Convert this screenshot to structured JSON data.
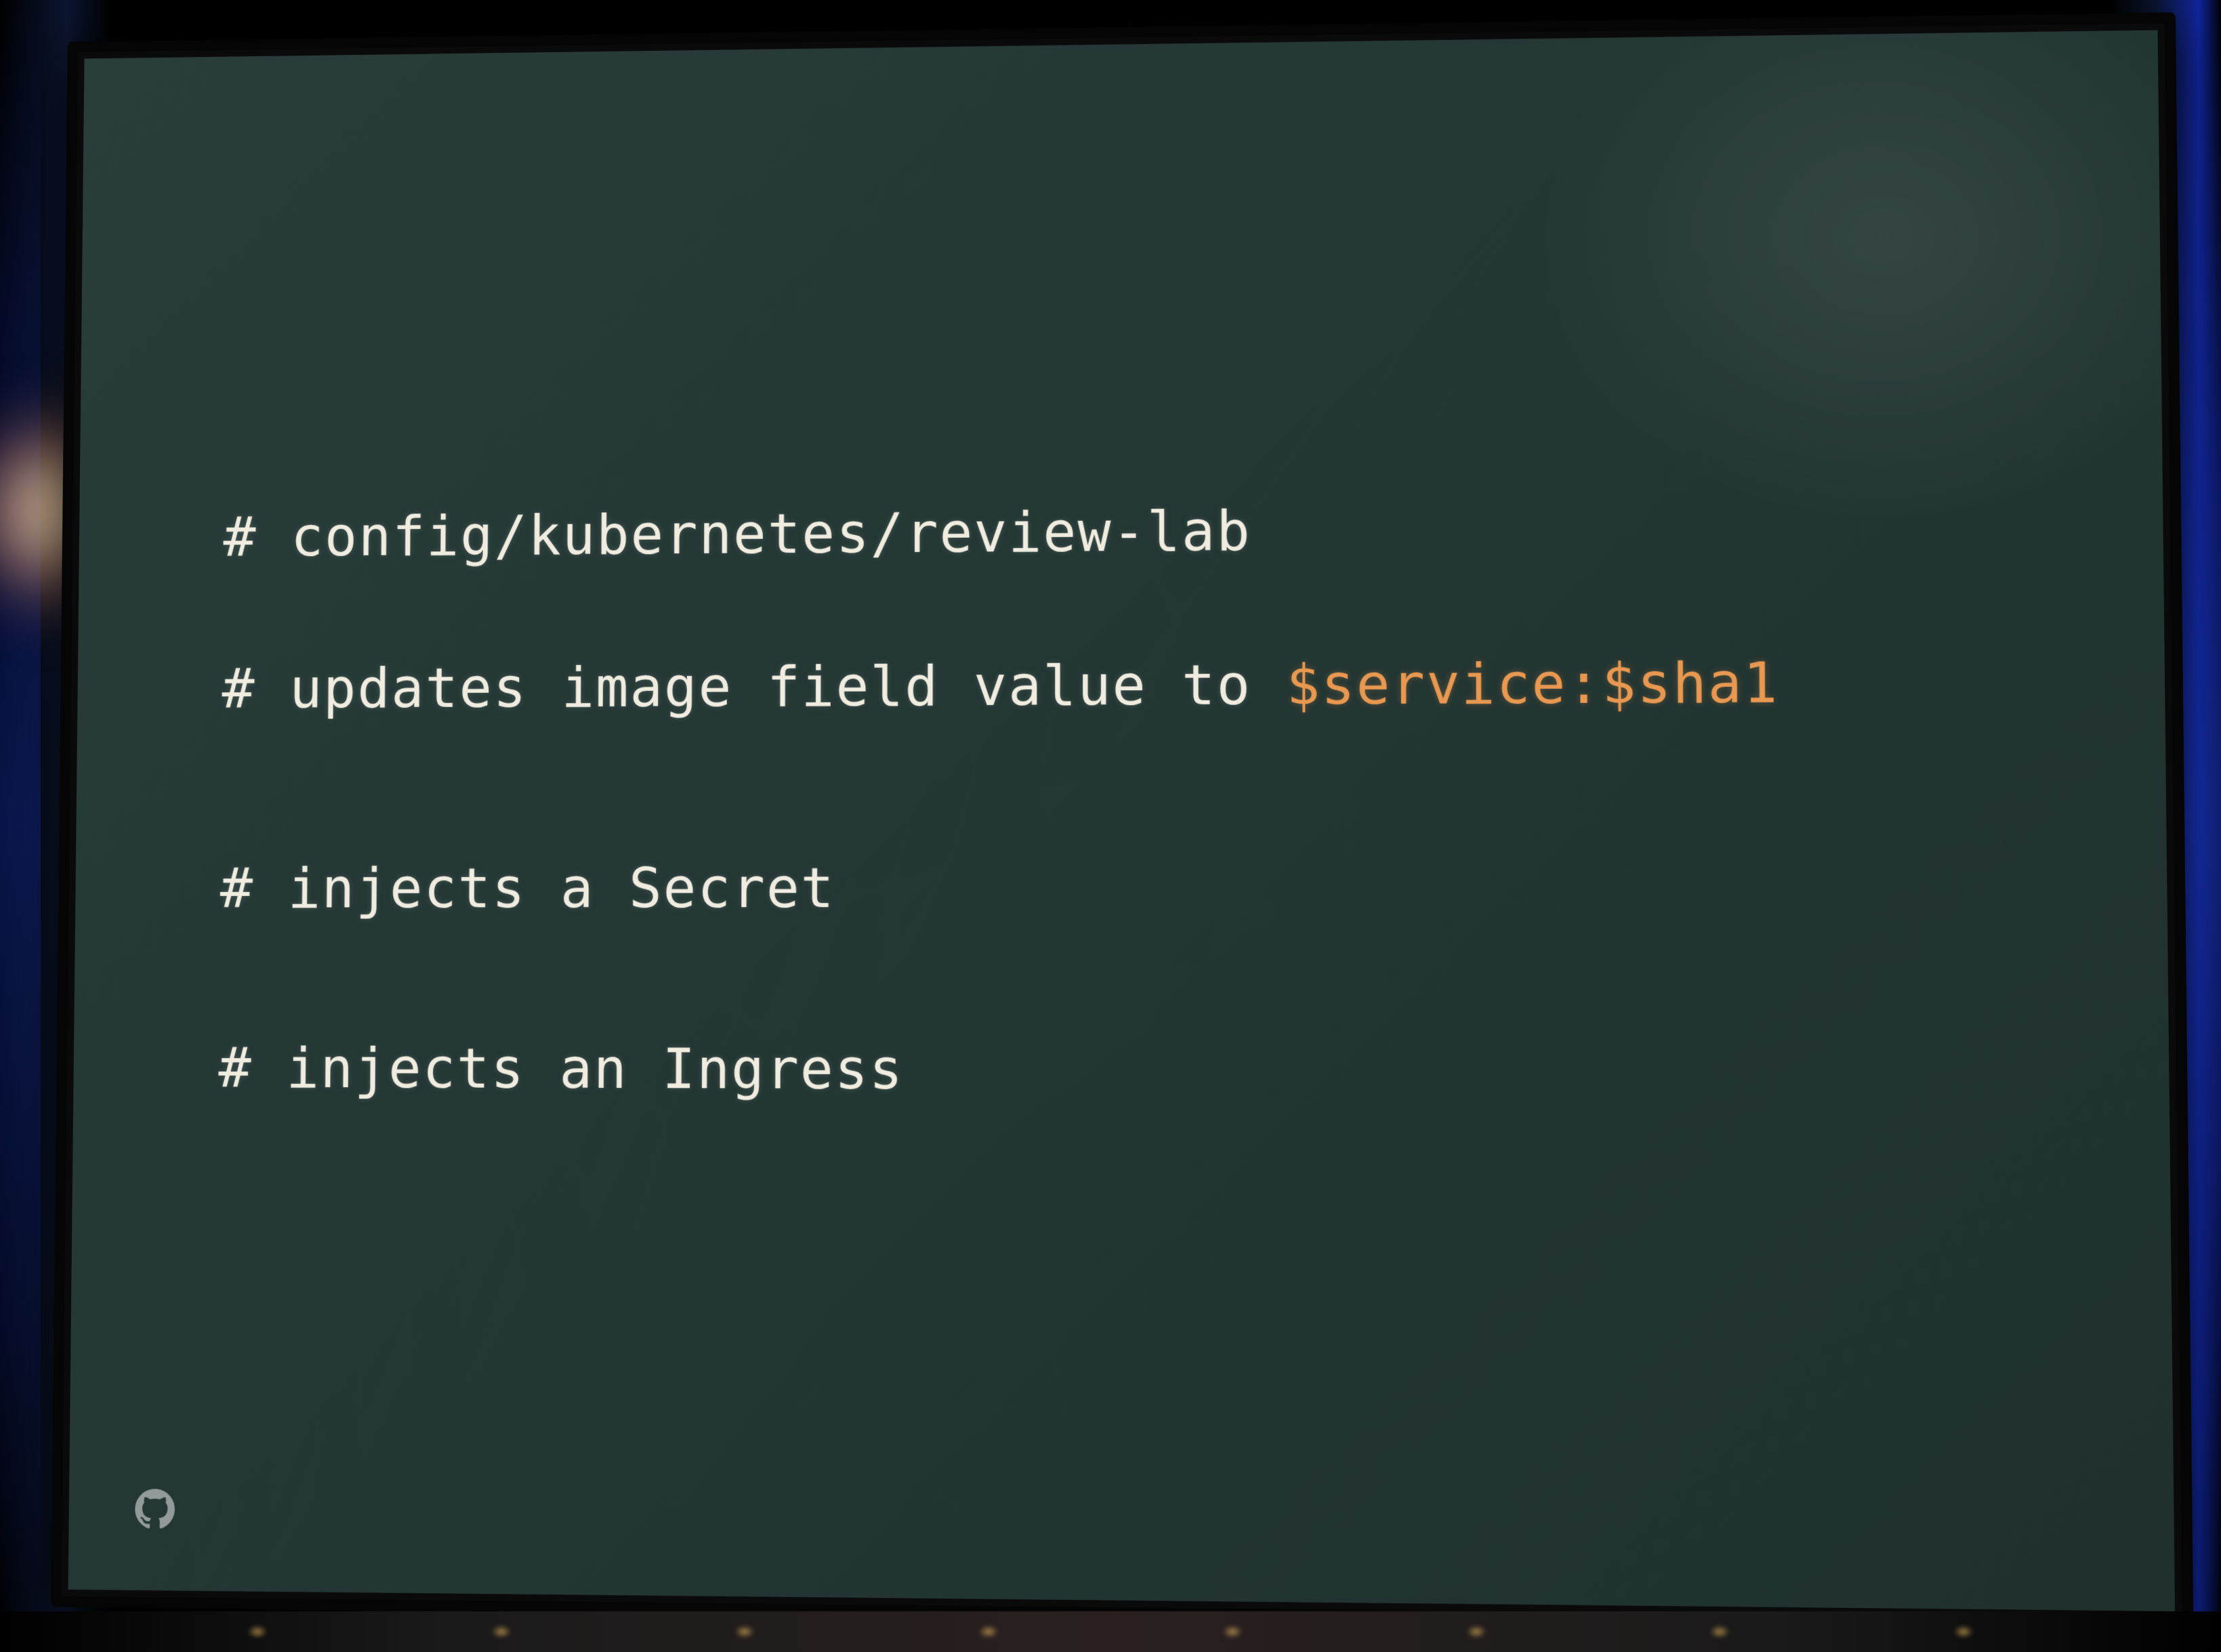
{
  "slide": {
    "lines": [
      {
        "prefix": "# ",
        "text": "config/kubernetes/review-lab",
        "highlight": ""
      },
      {
        "prefix": "# ",
        "text": "updates image field value to ",
        "highlight": "$service:$sha1"
      },
      {
        "prefix": "# ",
        "text": "injects a Secret",
        "highlight": ""
      },
      {
        "prefix": "# ",
        "text": "injects an Ingress",
        "highlight": ""
      }
    ],
    "logo": "github-icon",
    "colors": {
      "background": "#253836",
      "text": "#f0ece0",
      "highlight": "#e89850"
    }
  }
}
